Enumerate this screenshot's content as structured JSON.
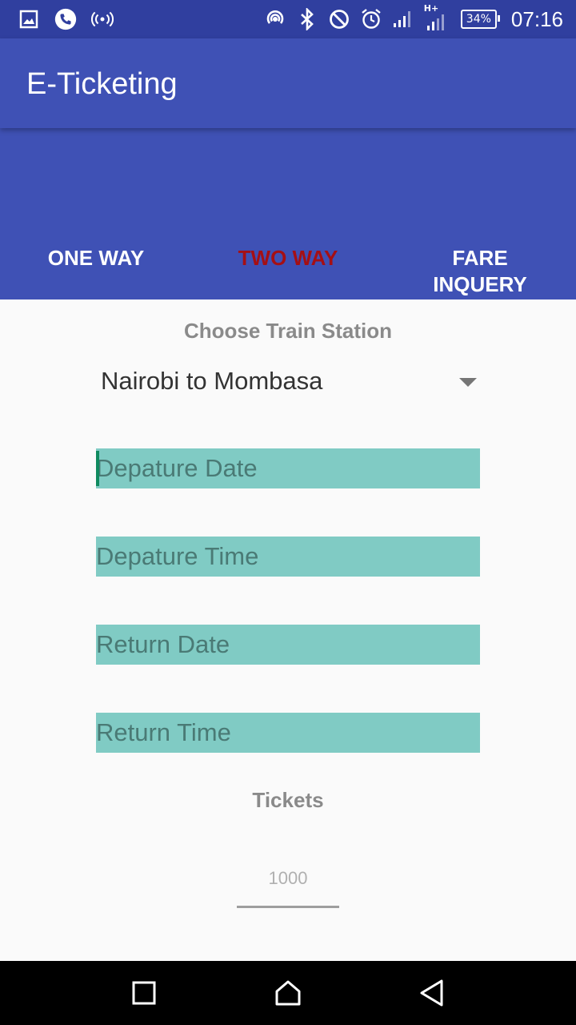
{
  "status_bar": {
    "icons_left": [
      "image-icon",
      "phone-icon",
      "hotspot-icon"
    ],
    "icons_right": [
      "nfc-icon",
      "bluetooth-icon",
      "dnd-icon",
      "alarm-icon",
      "signal-icon",
      "network-icon"
    ],
    "network_label": "H+",
    "battery": "34%",
    "time": "07:16"
  },
  "app_bar": {
    "title": "E-Ticketing"
  },
  "tabs": [
    {
      "label": "ONE WAY",
      "active": false
    },
    {
      "label": "TWO WAY",
      "active": true
    },
    {
      "label": "FARE INQUERY",
      "active": false
    }
  ],
  "form": {
    "station_label": "Choose Train Station",
    "station_selected": "Nairobi to Mombasa",
    "departure_date_placeholder": "Depature Date",
    "departure_time_placeholder": "Depature Time",
    "return_date_placeholder": "Return Date",
    "return_time_placeholder": "Return Time",
    "tickets_label": "Tickets",
    "tickets_value": "1000"
  },
  "colors": {
    "status_bar": "#303f9f",
    "primary": "#3f51b5",
    "active_tab": "#a50f14",
    "field_bg": "#80cbc4"
  },
  "nav_bar": {
    "buttons": [
      "recent-apps-icon",
      "home-icon",
      "back-icon"
    ]
  }
}
